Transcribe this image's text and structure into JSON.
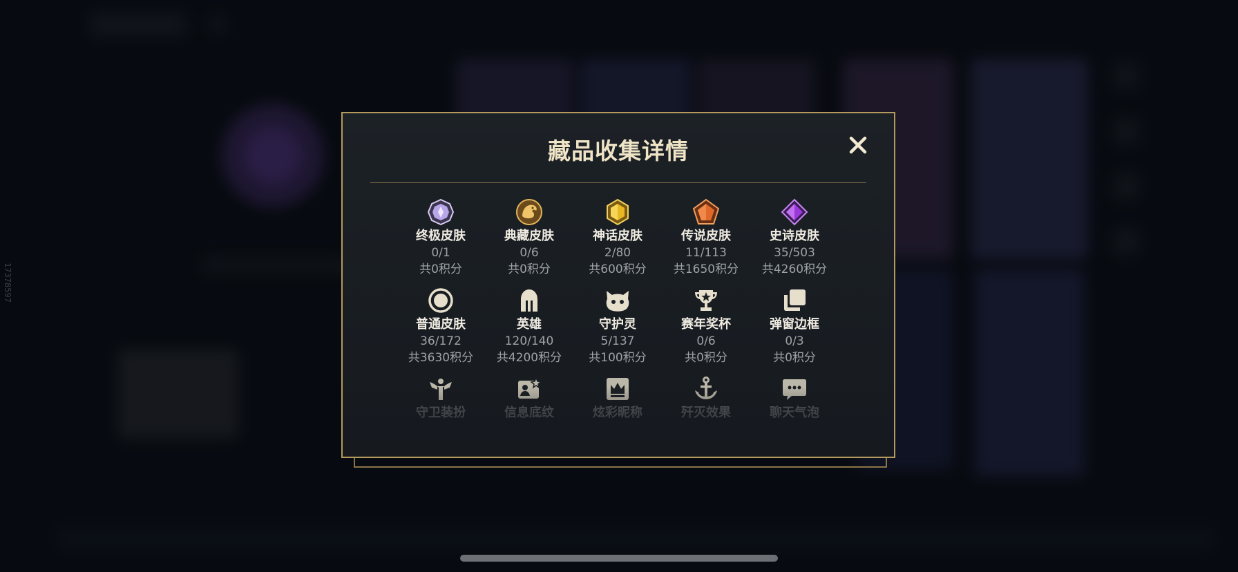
{
  "side_id": "17378597",
  "modal": {
    "title": "藏品收集详情",
    "close_icon": "close-icon"
  },
  "collection": [
    {
      "name": "终极皮肤",
      "count": "0/1",
      "points": "共0积分",
      "icon": "ultimate-gem-icon"
    },
    {
      "name": "典藏皮肤",
      "count": "0/6",
      "points": "共0积分",
      "icon": "dragon-emblem-icon"
    },
    {
      "name": "神话皮肤",
      "count": "2/80",
      "points": "共600积分",
      "icon": "mythic-gem-icon"
    },
    {
      "name": "传说皮肤",
      "count": "11/113",
      "points": "共1650积分",
      "icon": "legendary-gem-icon"
    },
    {
      "name": "史诗皮肤",
      "count": "35/503",
      "points": "共4260积分",
      "icon": "epic-gem-icon"
    },
    {
      "name": "普通皮肤",
      "count": "36/172",
      "points": "共3630积分",
      "icon": "normal-skin-icon"
    },
    {
      "name": "英雄",
      "count": "120/140",
      "points": "共4200积分",
      "icon": "helmet-icon"
    },
    {
      "name": "守护灵",
      "count": "5/137",
      "points": "共100积分",
      "icon": "guardian-spirit-icon"
    },
    {
      "name": "赛年奖杯",
      "count": "0/6",
      "points": "共0积分",
      "icon": "trophy-icon"
    },
    {
      "name": "弹窗边框",
      "count": "0/3",
      "points": "共0积分",
      "icon": "frame-icon"
    },
    {
      "name": "守卫装扮",
      "count": "",
      "points": "",
      "icon": "ward-skin-icon"
    },
    {
      "name": "信息底纹",
      "count": "",
      "points": "",
      "icon": "info-card-icon"
    },
    {
      "name": "炫彩昵称",
      "count": "",
      "points": "",
      "icon": "crown-name-icon"
    },
    {
      "name": "歼灭效果",
      "count": "",
      "points": "",
      "icon": "anchor-effect-icon"
    },
    {
      "name": "聊天气泡",
      "count": "",
      "points": "",
      "icon": "chat-bubble-icon"
    }
  ],
  "colors": {
    "accent_gold": "#b59a5e",
    "title_text": "#efe4c6",
    "dim_text": "#9ea3a8"
  }
}
